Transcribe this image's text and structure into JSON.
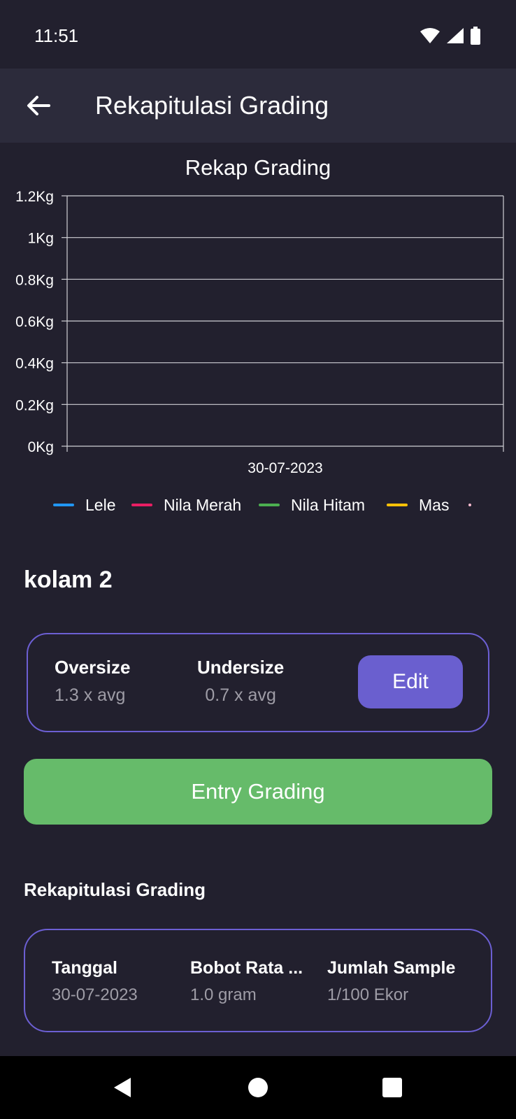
{
  "status_bar": {
    "time": "11:51",
    "icons": [
      "wifi-icon",
      "signal-icon",
      "battery-icon"
    ]
  },
  "app_bar": {
    "title": "Rekapitulasi Grading",
    "back_icon": "arrow-left-icon"
  },
  "chart_data": {
    "type": "line",
    "title": "Rekap Grading",
    "categories": [
      "30-07-2023"
    ],
    "y_ticks": [
      "0Kg",
      "0.2Kg",
      "0.4Kg",
      "0.6Kg",
      "0.8Kg",
      "1Kg",
      "1.2Kg"
    ],
    "ylim": [
      0,
      1.2
    ],
    "grid": true,
    "legend_position": "bottom",
    "series": [
      {
        "name": "Lele",
        "color": "#2196f3",
        "values": []
      },
      {
        "name": "Nila Merah",
        "color": "#e91e63",
        "values": []
      },
      {
        "name": "Nila Hitam",
        "color": "#4caf50",
        "values": []
      },
      {
        "name": "Mas",
        "color": "#ffc107",
        "values": []
      },
      {
        "name": "",
        "color": "#f8bbd0",
        "values": []
      }
    ]
  },
  "pond": {
    "name": "kolam 2",
    "oversize": {
      "label": "Oversize",
      "value": "1.3 x avg"
    },
    "undersize": {
      "label": "Undersize",
      "value": "0.7 x avg"
    },
    "edit_label": "Edit"
  },
  "entry_button": "Entry Grading",
  "recap": {
    "title": "Rekapitulasi Grading",
    "rows": [
      {
        "date_label": "Tanggal",
        "date_value": "30-07-2023",
        "weight_label": "Bobot Rata ...",
        "weight_value": "1.0 gram",
        "sample_label": "Jumlah Sample",
        "sample_value": "1/100 Ekor"
      }
    ]
  },
  "nav": {
    "back_icon": "triangle-back-icon",
    "home_icon": "circle-home-icon",
    "recents_icon": "square-recents-icon"
  }
}
